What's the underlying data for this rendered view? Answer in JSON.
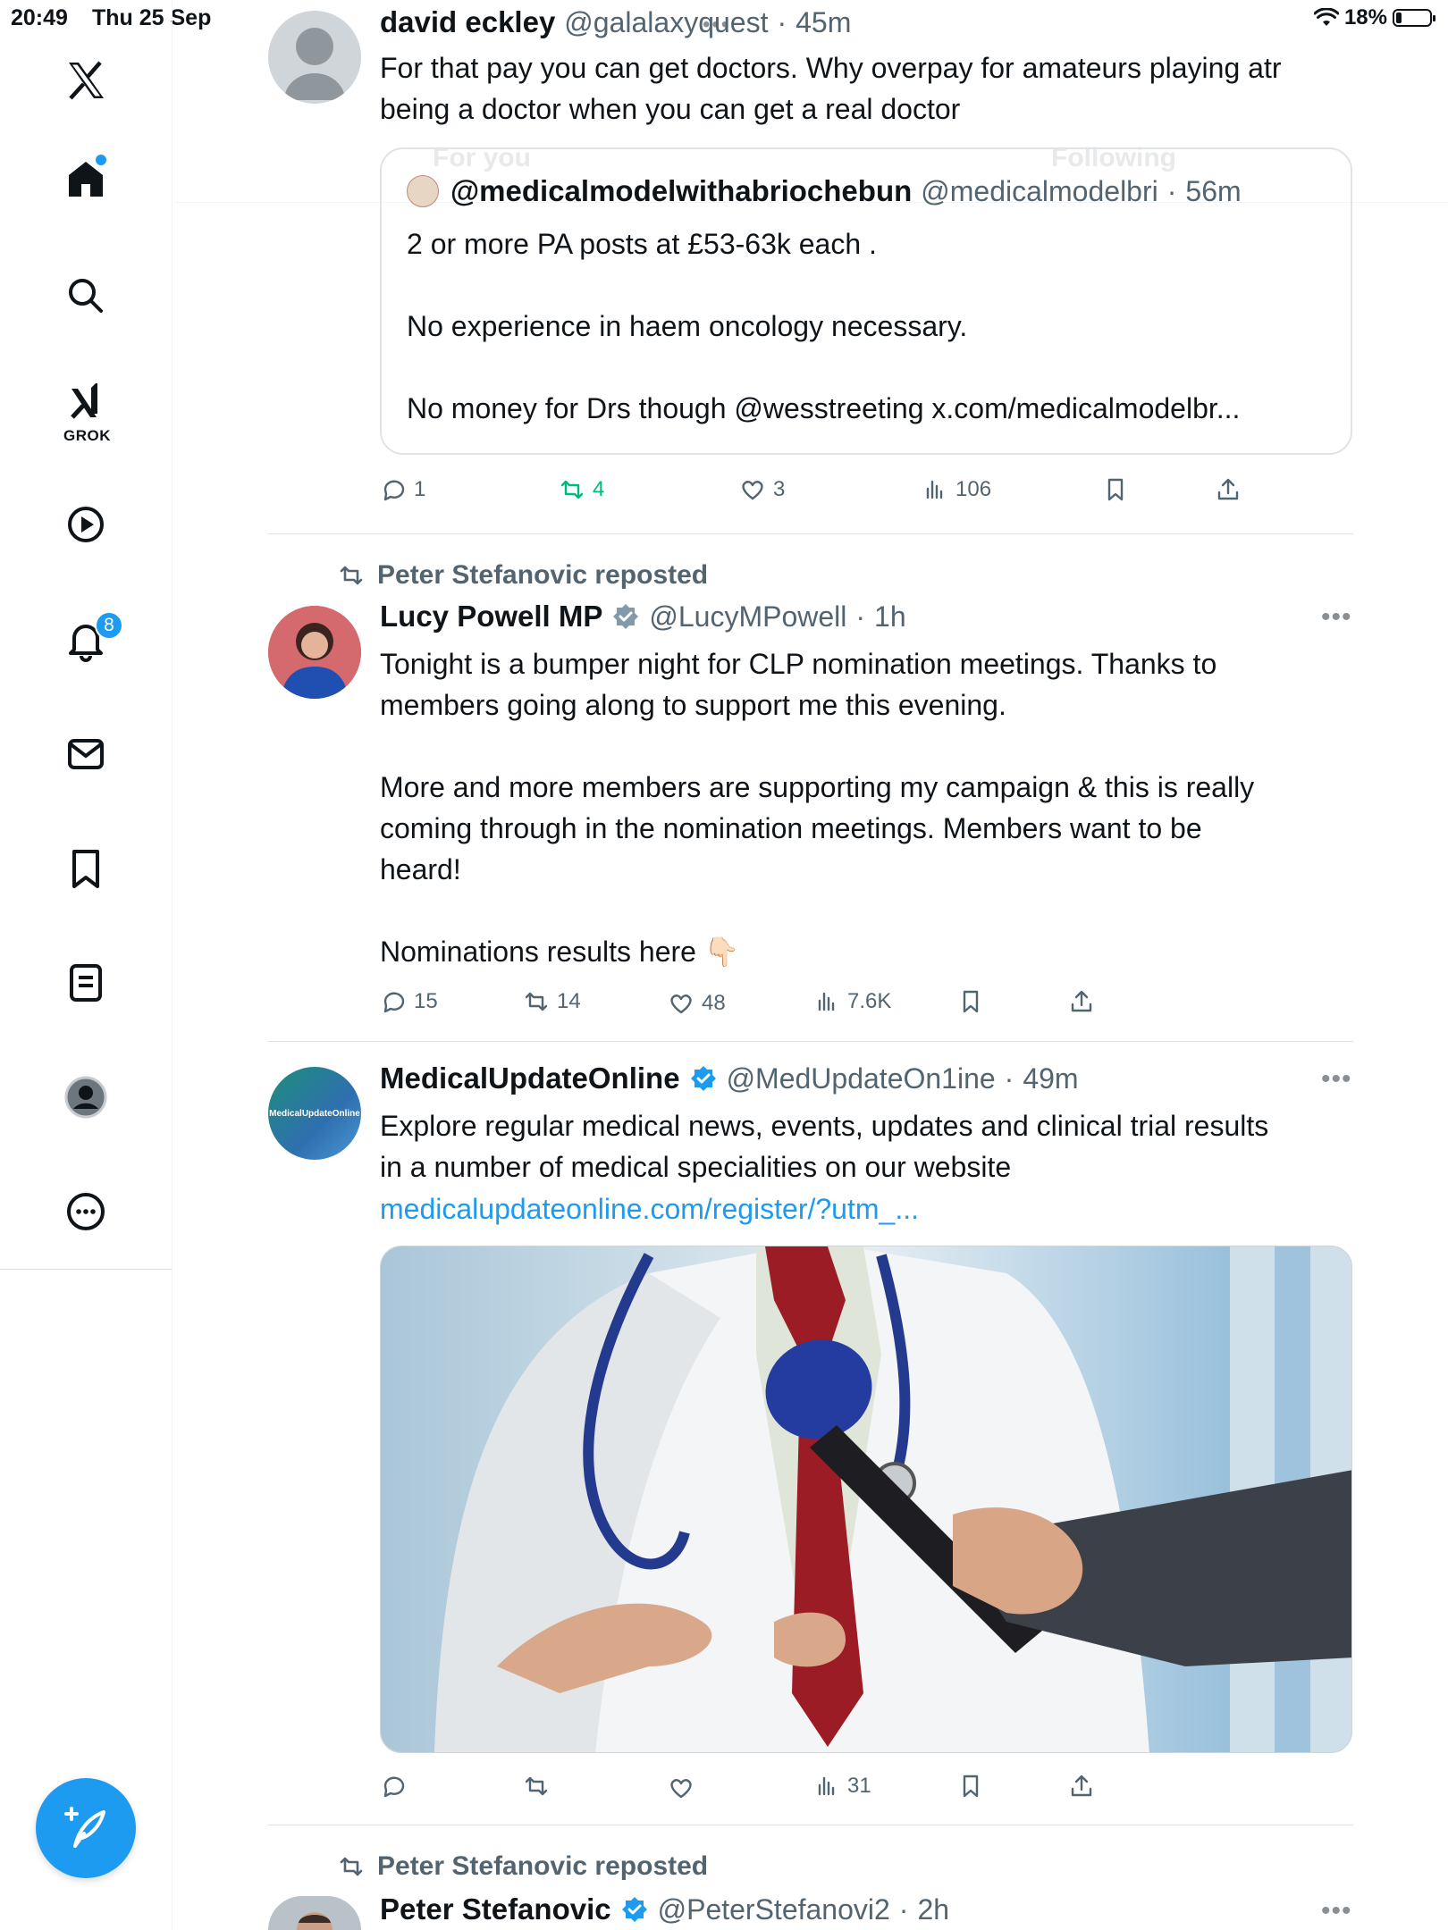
{
  "status_bar": {
    "time": "20:49",
    "date": "Thu 25 Sep",
    "battery": "18%",
    "battery_level": 0.18
  },
  "header": {
    "tab_for_you": "For you",
    "tab_following": "Following"
  },
  "sidebar": {
    "items": [
      "x-logo",
      "home",
      "search",
      "grok",
      "video",
      "notifications",
      "messages",
      "bookmarks",
      "lists",
      "profile",
      "more"
    ],
    "grok_label": "GROK",
    "notifications_count": "8"
  },
  "accent_color": "#1d9bf0",
  "tweets": [
    {
      "name": "david eckley",
      "handle": "@galalaxyquest",
      "time": "45m",
      "text": "For that pay you can get doctors. Why overpay for amateurs playing atr\nbeing a doctor when you can get a real doctor",
      "quote": {
        "name": "@medicalmodelwithabriochebun",
        "handle": "@medicalmodelbri",
        "time": "56m",
        "text": "2 or more PA posts at £53-63k each .\n\nNo experience in haem oncology necessary.\n\nNo money for Drs though @wesstreeting x.com/medicalmodelbr..."
      },
      "replies": "1",
      "reposts": "4",
      "likes": "3",
      "views": "106"
    },
    {
      "reposted_by": "Peter Stefanovic reposted",
      "name": "Lucy Powell MP",
      "handle": "@LucyMPowell",
      "time": "1h",
      "text": "Tonight is a bumper night for CLP nomination meetings. Thanks to\nmembers going along to support me this evening.\n\nMore and more members are supporting my campaign & this is really\ncoming through in the nomination meetings. Members want to be\nheard!\n\nNominations results here 👇🏻",
      "replies": "15",
      "reposts": "14",
      "likes": "48",
      "views": "7.6K"
    },
    {
      "name": "MedicalUpdateOnline",
      "handle": "@MedUpdateOn1ine",
      "time": "49m",
      "avatar_text": "MedicalUpdateOnline",
      "text": "Explore regular medical news, events, updates and clinical trial results\nin a number of medical specialities on our website",
      "link": "medicalupdateonline.com/register/?utm_...",
      "views": "31"
    },
    {
      "reposted_by": "Peter Stefanovic reposted",
      "name": "Peter Stefanovic",
      "handle": "@PeterStefanovi2",
      "time": "2h"
    }
  ]
}
